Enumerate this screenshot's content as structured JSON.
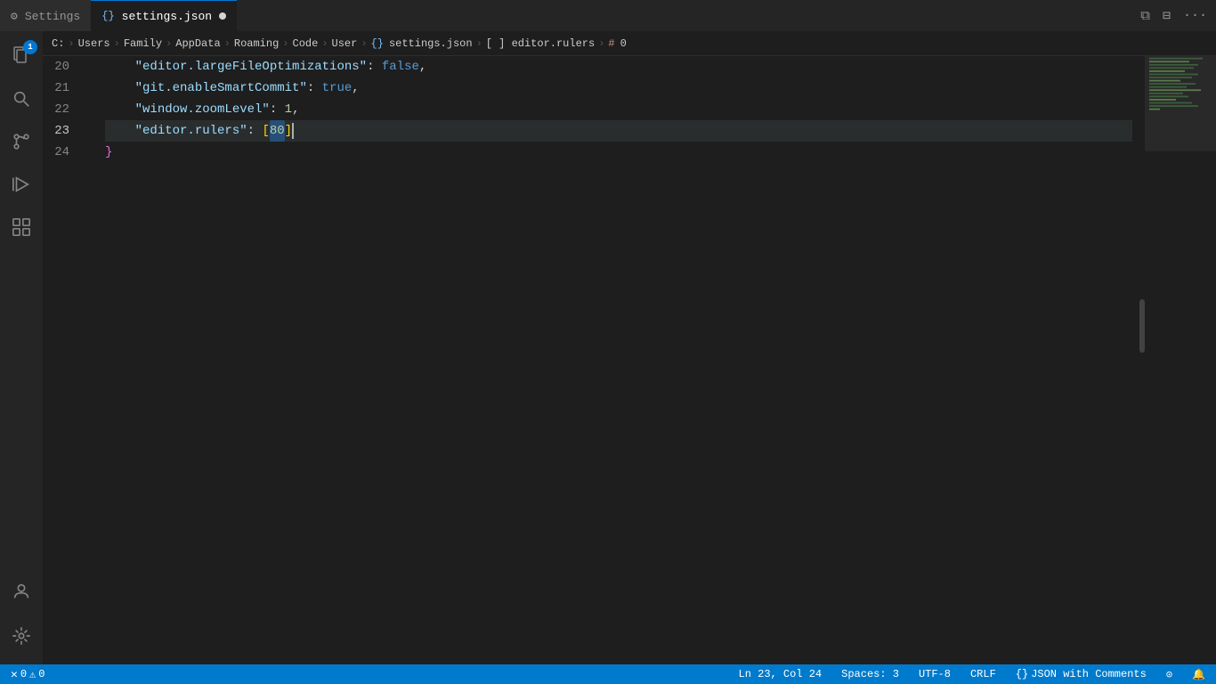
{
  "tabs": [
    {
      "id": "settings",
      "label": "Settings",
      "icon": "⚙",
      "active": false,
      "modified": false
    },
    {
      "id": "settings-json",
      "label": "settings.json",
      "icon": "{}",
      "active": true,
      "modified": true
    }
  ],
  "titlebar": {
    "copy_icon": "⧉",
    "split_icon": "⊟",
    "more_icon": "···"
  },
  "breadcrumb": {
    "items": [
      "C:",
      "Users",
      "Family",
      "AppData",
      "Roaming",
      "Code",
      "User",
      "settings.json",
      "[ ] editor.rulers",
      "# 0"
    ]
  },
  "activity": {
    "badge": "1",
    "items": [
      {
        "id": "explorer",
        "icon": "⬛",
        "active": false
      },
      {
        "id": "search",
        "icon": "🔍",
        "active": false
      },
      {
        "id": "source-control",
        "icon": "⑂",
        "active": false
      },
      {
        "id": "run",
        "icon": "▷",
        "active": false
      },
      {
        "id": "extensions",
        "icon": "⊞",
        "active": false
      }
    ],
    "bottom": [
      {
        "id": "account",
        "icon": "👤"
      },
      {
        "id": "settings",
        "icon": "⚙"
      }
    ]
  },
  "code": {
    "lines": [
      {
        "num": 20,
        "content": "    \"editor.largeFileOptimizations\": false,",
        "active": false
      },
      {
        "num": 21,
        "content": "    \"git.enableSmartCommit\": true,",
        "active": false
      },
      {
        "num": 22,
        "content": "    \"window.zoomLevel\": 1,",
        "active": false
      },
      {
        "num": 23,
        "content": "    \"editor.rulers\": [80]",
        "active": true
      },
      {
        "num": 24,
        "content": "}",
        "active": false
      }
    ]
  },
  "status_bar": {
    "error_count": "0",
    "warning_count": "0",
    "line_col": "Ln 23, Col 24",
    "spaces": "Spaces: 3",
    "encoding": "UTF-8",
    "line_ending": "CRLF",
    "language": "JSON with Comments",
    "feedback_icon": "⊙",
    "bell_icon": "🔔"
  }
}
